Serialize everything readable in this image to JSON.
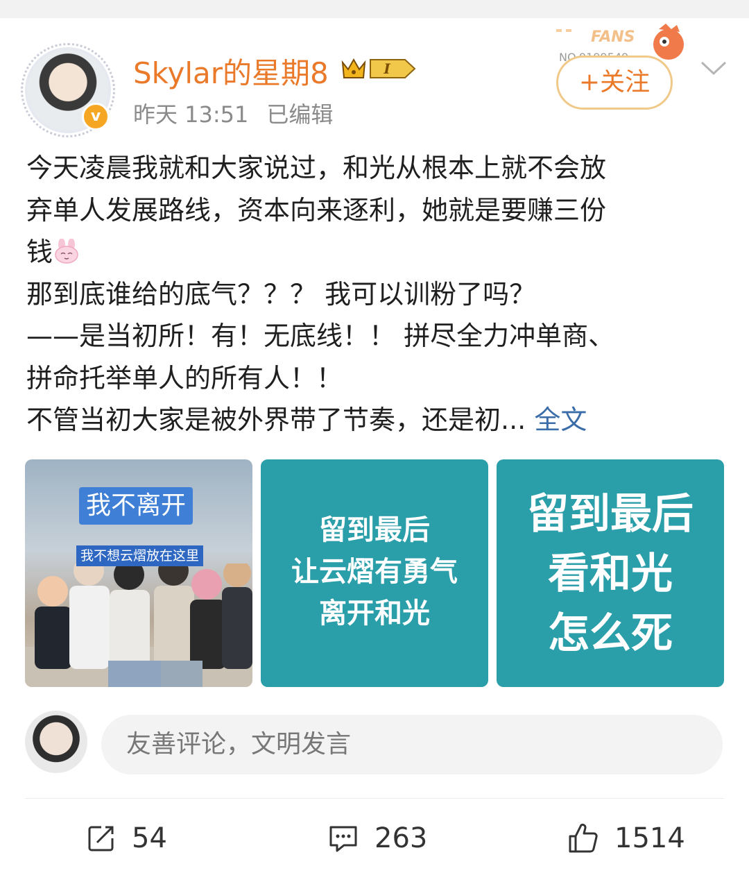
{
  "header": {
    "username": "Skylar的星期8",
    "crown_badge_label": "I",
    "verified_mark": "v",
    "time": "昨天 13:51",
    "edited": "已编辑",
    "fans_badge_label": "FANS",
    "fans_badge_number": "NO.9199549",
    "follow_label": "+关注",
    "accent_color": "#ea7a2a"
  },
  "post": {
    "lines": [
      "今天凌晨我就和大家说过，和光从根本上就不会放",
      "弃单人发展路线，资本向来逐利，她就是要赚三份",
      "钱",
      "那到底谁给的底气？？？ 我可以训粉了吗？",
      "——是当初所！有！无底线！！ 拼尽全力冲单商、",
      "拼命托举单人的所有人！！",
      "不管当初大家是被外界带了节奏，还是初..."
    ],
    "emoji": "bunny-emoji",
    "more_link": "全文",
    "link_color": "#3b6ea8"
  },
  "images": {
    "photo": {
      "caption1": "我不离开",
      "caption2": "我不想云熠放在这里"
    },
    "teal1": {
      "lines": [
        "留到最后",
        "让云熠有勇气",
        "离开和光"
      ]
    },
    "teal2": {
      "lines": [
        "留到最后",
        "看和光",
        "怎么死"
      ]
    },
    "teal_color": "#2a9ea9"
  },
  "comment": {
    "placeholder": "友善评论，文明发言"
  },
  "actions": {
    "repost_count": "54",
    "comment_count": "263",
    "like_count": "1514"
  }
}
